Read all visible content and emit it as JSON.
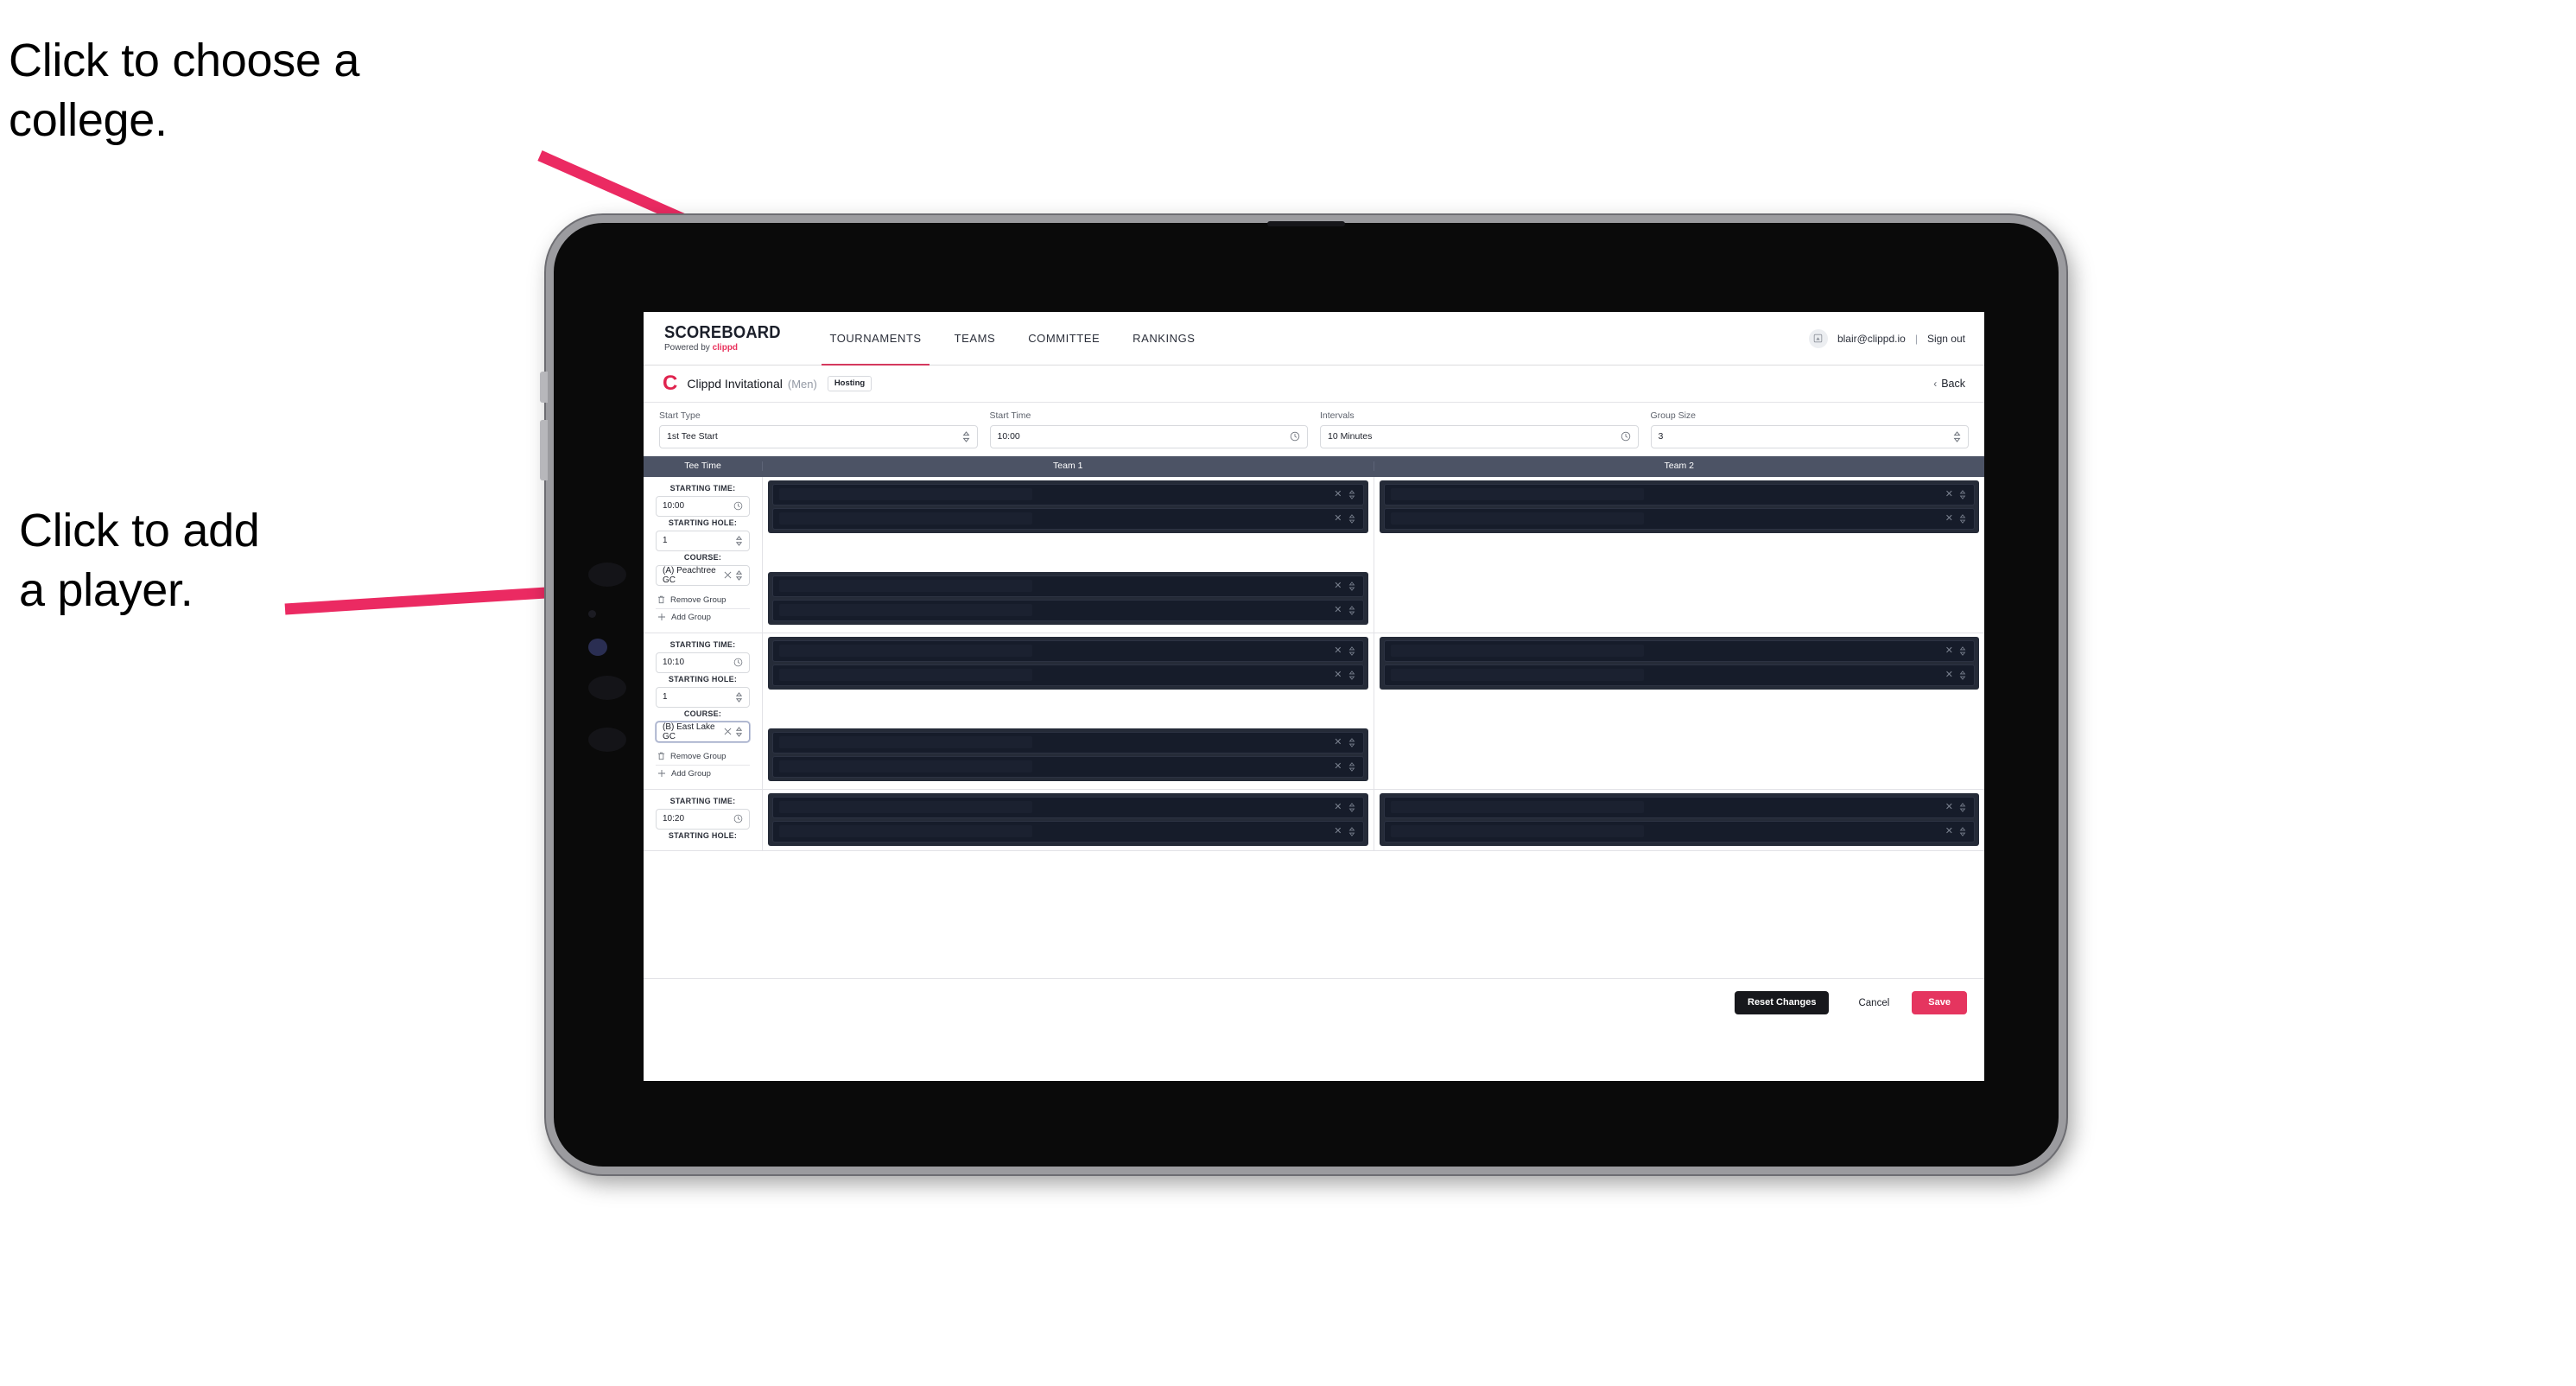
{
  "annotations": [
    {
      "id": "college",
      "text": "Click to choose a\ncollege."
    },
    {
      "id": "player",
      "text": "Click to add\na player."
    }
  ],
  "colors": {
    "accent_pink": "#e5355f",
    "annotation_arrow": "#eb2a62",
    "table_header_bg": "#4c5365",
    "group_block_bg": "#252b38",
    "player_slot_bg": "#161c2a",
    "brand_dark": "#1b1f2a"
  },
  "topnav": {
    "brand_title": "SCOREBOARD",
    "brand_sub_prefix": "Powered by ",
    "brand_sub_name": "clippd",
    "links": [
      {
        "label": "TOURNAMENTS",
        "active": true
      },
      {
        "label": "TEAMS",
        "active": false
      },
      {
        "label": "COMMITTEE",
        "active": false
      },
      {
        "label": "RANKINGS",
        "active": false
      }
    ],
    "user_email": "blair@clippd.io",
    "separator": "|",
    "sign_out": "Sign out",
    "avatar_icon": "user-avatar-icon"
  },
  "tournament_header": {
    "logo_letter": "C",
    "name": "Clippd Invitational",
    "gender": "(Men)",
    "badge": "Hosting",
    "back_label": "Back",
    "back_icon": "chevron-left-icon"
  },
  "controls": [
    {
      "label": "Start Type",
      "value": "1st Tee Start",
      "icon": "stepper-updown-icon"
    },
    {
      "label": "Start Time",
      "value": "10:00",
      "icon": "clock-icon"
    },
    {
      "label": "Intervals",
      "value": "10 Minutes",
      "icon": "clock-icon"
    },
    {
      "label": "Group Size",
      "value": "3",
      "icon": "stepper-updown-icon"
    }
  ],
  "table_headers": {
    "tee_time": "Tee Time",
    "team_1": "Team 1",
    "team_2": "Team 2"
  },
  "field_labels": {
    "starting_time": "STARTING TIME:",
    "starting_hole": "STARTING HOLE:",
    "course": "COURSE:"
  },
  "group_actions": {
    "remove": "Remove Group",
    "add": "Add Group",
    "remove_icon": "trash-icon",
    "add_icon": "plus-icon"
  },
  "tee_rows": [
    {
      "starting_time": "10:00",
      "starting_hole": "1",
      "course": "(A) Peachtree GC",
      "course_focused": false,
      "team1_groups": 2,
      "team2_groups": 1,
      "slots_per_group": 2
    },
    {
      "starting_time": "10:10",
      "starting_hole": "1",
      "course": "(B) East Lake GC",
      "course_focused": true,
      "team1_groups": 2,
      "team2_groups": 1,
      "slots_per_group": 2
    },
    {
      "starting_time": "10:20",
      "starting_hole": "",
      "course": "",
      "course_focused": false,
      "team1_groups": 1,
      "team2_groups": 1,
      "slots_per_group": 2,
      "partial": true
    }
  ],
  "footer": {
    "reset": "Reset Changes",
    "cancel": "Cancel",
    "save": "Save"
  }
}
